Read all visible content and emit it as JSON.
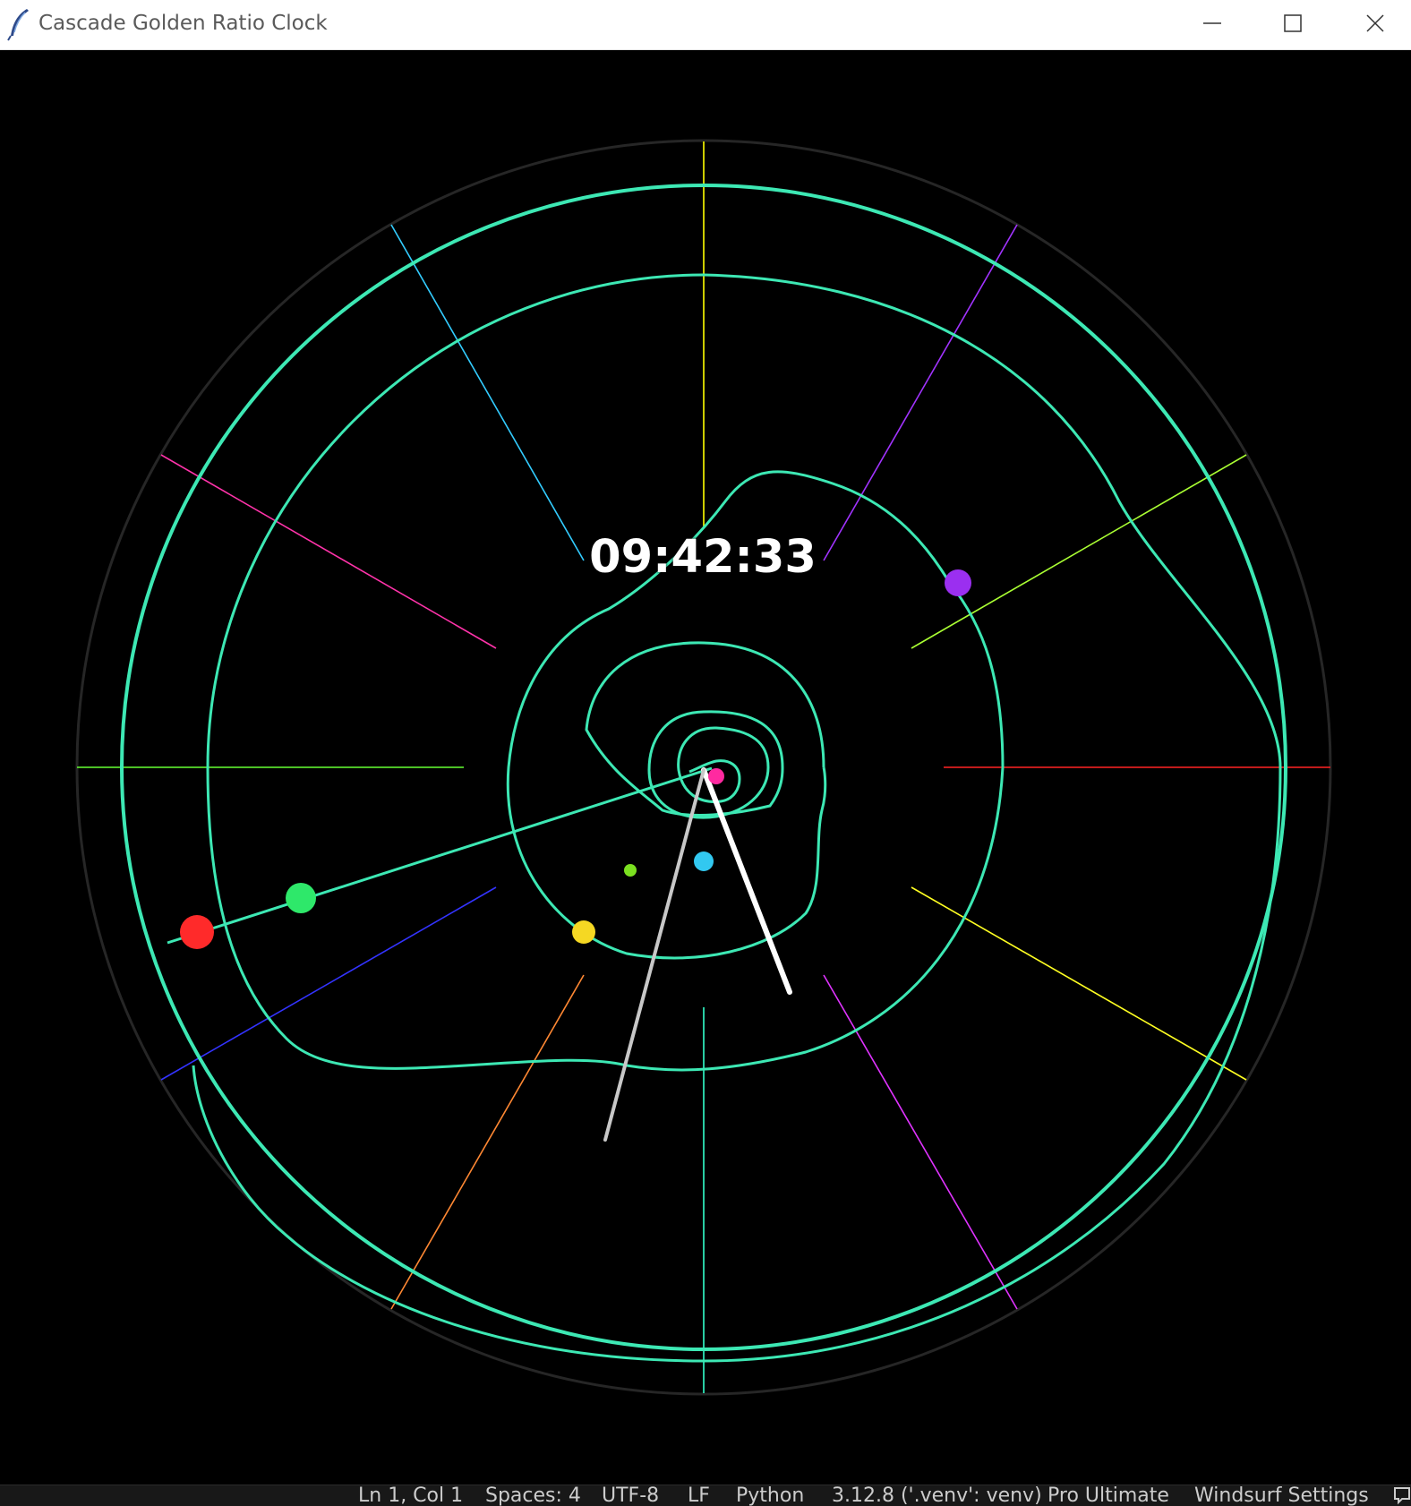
{
  "window": {
    "title": "Cascade Golden Ratio Clock",
    "app_icon": "feather-icon",
    "controls": [
      "minimize-icon",
      "maximize-icon",
      "close-icon"
    ]
  },
  "clock": {
    "time": "09:42:33",
    "ring_color": "#3de8b4",
    "hand_colors": {
      "hour": "#ffffff",
      "minute": "#c8c8c8"
    },
    "orb_colors": [
      "#ff2a2a",
      "#2ee86a",
      "#f5d823",
      "#32c8f0",
      "#7be020",
      "#9b2ff0",
      "#ff2aa0"
    ],
    "ray_colors": [
      "#ffff00",
      "#a133ff",
      "#aaff33",
      "#ff2222",
      "#ffff22",
      "#e033ff",
      "#33ffcc",
      "#ff8833",
      "#3333ff",
      "#66ff33",
      "#ff33aa",
      "#33ccff"
    ]
  },
  "statusbar": {
    "position": "Ln 1, Col 1",
    "spaces": "Spaces: 4",
    "encoding": "UTF-8",
    "eol": "LF",
    "language": "Python",
    "interpreter": "3.12.8 ('.venv': venv)",
    "plan": "Pro Ultimate",
    "settings": "Windsurf Settings"
  }
}
